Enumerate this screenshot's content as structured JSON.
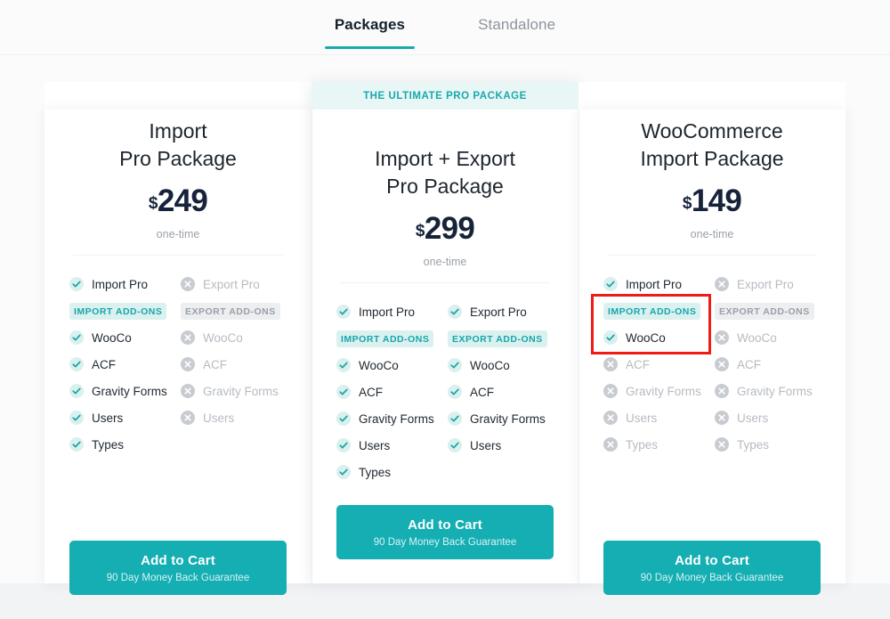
{
  "tabs": [
    {
      "label": "Packages",
      "active": true
    },
    {
      "label": "Standalone",
      "active": false
    }
  ],
  "featured_banner": "THE ULTIMATE PRO PACKAGE",
  "labels": {
    "import_addons": "IMPORT ADD-ONS",
    "export_addons": "EXPORT ADD-ONS",
    "period": "one-time",
    "cta_title": "Add to Cart",
    "cta_subtitle": "90 Day Money Back Guarantee",
    "currency": "$"
  },
  "colors": {
    "accent_teal": "#14aeb4",
    "banner_bg": "#e8f7f6",
    "badge_on_bg": "#dbf1ef",
    "badge_off_bg": "#eceef0",
    "price_text": "#16233a",
    "highlight_red": "#ee1c16",
    "page_bg": "#f2f3f5"
  },
  "cards": [
    {
      "title": "Import\nPro Package",
      "price": "249",
      "featured": false,
      "import": {
        "head": {
          "label": "Import Pro",
          "on": true
        },
        "items": [
          {
            "label": "WooCo",
            "on": true
          },
          {
            "label": "ACF",
            "on": true
          },
          {
            "label": "Gravity Forms",
            "on": true
          },
          {
            "label": "Users",
            "on": true
          },
          {
            "label": "Types",
            "on": true
          }
        ]
      },
      "export": {
        "head": {
          "label": "Export Pro",
          "on": false
        },
        "items": [
          {
            "label": "WooCo",
            "on": false
          },
          {
            "label": "ACF",
            "on": false
          },
          {
            "label": "Gravity Forms",
            "on": false
          },
          {
            "label": "Users",
            "on": false
          }
        ]
      }
    },
    {
      "title": "Import + Export\nPro Package",
      "price": "299",
      "featured": true,
      "import": {
        "head": {
          "label": "Import Pro",
          "on": true
        },
        "items": [
          {
            "label": "WooCo",
            "on": true
          },
          {
            "label": "ACF",
            "on": true
          },
          {
            "label": "Gravity Forms",
            "on": true
          },
          {
            "label": "Users",
            "on": true
          },
          {
            "label": "Types",
            "on": true
          }
        ]
      },
      "export": {
        "head": {
          "label": "Export Pro",
          "on": true
        },
        "items": [
          {
            "label": "WooCo",
            "on": true
          },
          {
            "label": "ACF",
            "on": true
          },
          {
            "label": "Gravity Forms",
            "on": true
          },
          {
            "label": "Users",
            "on": true
          }
        ]
      }
    },
    {
      "title": "WooCommerce\nImport Package",
      "price": "149",
      "featured": false,
      "highlight": true,
      "import": {
        "head": {
          "label": "Import Pro",
          "on": true
        },
        "items": [
          {
            "label": "WooCo",
            "on": true
          },
          {
            "label": "ACF",
            "on": false
          },
          {
            "label": "Gravity Forms",
            "on": false
          },
          {
            "label": "Users",
            "on": false
          },
          {
            "label": "Types",
            "on": false
          }
        ]
      },
      "export": {
        "head": {
          "label": "Export Pro",
          "on": false
        },
        "items": [
          {
            "label": "WooCo",
            "on": false
          },
          {
            "label": "ACF",
            "on": false
          },
          {
            "label": "Gravity Forms",
            "on": false
          },
          {
            "label": "Users",
            "on": false
          },
          {
            "label": "Types",
            "on": false
          }
        ]
      }
    }
  ]
}
